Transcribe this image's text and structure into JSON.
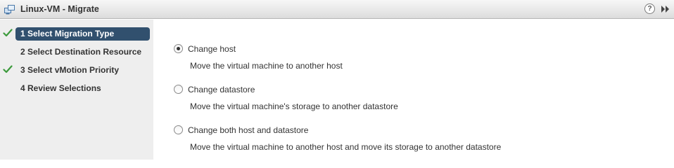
{
  "window": {
    "title": "Linux-VM - Migrate",
    "title_icon": "vm-migrate-icon",
    "help_icon_glyph": "?",
    "help_icon": "help-icon",
    "expand_icon": "double-chevron-right-icon"
  },
  "steps": [
    {
      "label": "1  Select Migration Type",
      "completed": true,
      "active": true
    },
    {
      "label": "2  Select Destination Resource",
      "completed": false,
      "active": false
    },
    {
      "label": "3  Select vMotion Priority",
      "completed": true,
      "active": false
    },
    {
      "label": "4  Review Selections",
      "completed": false,
      "active": false
    }
  ],
  "options": [
    {
      "label": "Change host",
      "description": "Move the virtual machine to another host",
      "selected": true
    },
    {
      "label": "Change datastore",
      "description": "Move the virtual machine's storage to another datastore",
      "selected": false
    },
    {
      "label": "Change both host and datastore",
      "description": "Move the virtual machine to another host and move its storage to another datastore",
      "selected": false
    }
  ],
  "colors": {
    "active_step_bg": "#31506e",
    "check_green": "#3c9a3c",
    "panel_bg": "#eeeeee",
    "text": "#333333"
  }
}
